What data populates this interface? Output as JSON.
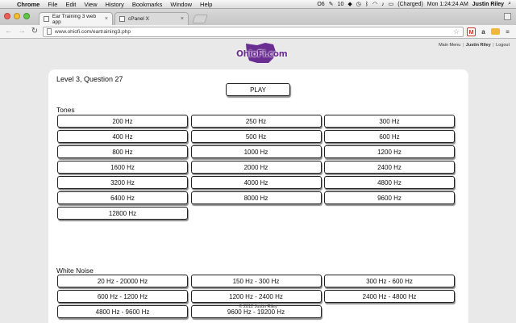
{
  "menubar": {
    "app": "Chrome",
    "items": [
      "File",
      "Edit",
      "View",
      "History",
      "Bookmarks",
      "Window",
      "Help"
    ],
    "status_tray": [
      "O6",
      "10",
      "(Charged)"
    ],
    "clock": "Mon 1:24:24 AM",
    "user": "Justin Riley"
  },
  "tabs": [
    {
      "title": "Ear Training 3 web app"
    },
    {
      "title": "cPanel X"
    }
  ],
  "toolbar": {
    "url": "www.ohiofi.com/eartraining3.php"
  },
  "site": {
    "logo_text": "OhioFi.com",
    "nav": {
      "main_menu": "Main Menu",
      "sep": "|",
      "user": "Justin Riley",
      "logout": "Logout"
    }
  },
  "quiz": {
    "title": "Level 3, Question 27",
    "play_label": "PLAY"
  },
  "tones": {
    "heading": "Tones",
    "buttons": [
      "200 Hz",
      "250 Hz",
      "300 Hz",
      "400 Hz",
      "500 Hz",
      "600 Hz",
      "800 Hz",
      "1000 Hz",
      "1200 Hz",
      "1600 Hz",
      "2000 Hz",
      "2400 Hz",
      "3200 Hz",
      "4000 Hz",
      "4800 Hz",
      "6400 Hz",
      "8000 Hz",
      "9600 Hz",
      "12800 Hz"
    ]
  },
  "noise": {
    "heading": "White Noise",
    "buttons": [
      "20 Hz - 20000 Hz",
      "150 Hz - 300 Hz",
      "300 Hz - 600 Hz",
      "600 Hz - 1200 Hz",
      "1200 Hz - 2400 Hz",
      "2400 Hz - 4800 Hz",
      "4800 Hz - 9600 Hz",
      "9600 Hz - 19200 Hz"
    ]
  },
  "footer": "© 2012 Justin Riley",
  "colors": {
    "brand": "#6a2d91",
    "page_bg": "#e9e9e9"
  }
}
